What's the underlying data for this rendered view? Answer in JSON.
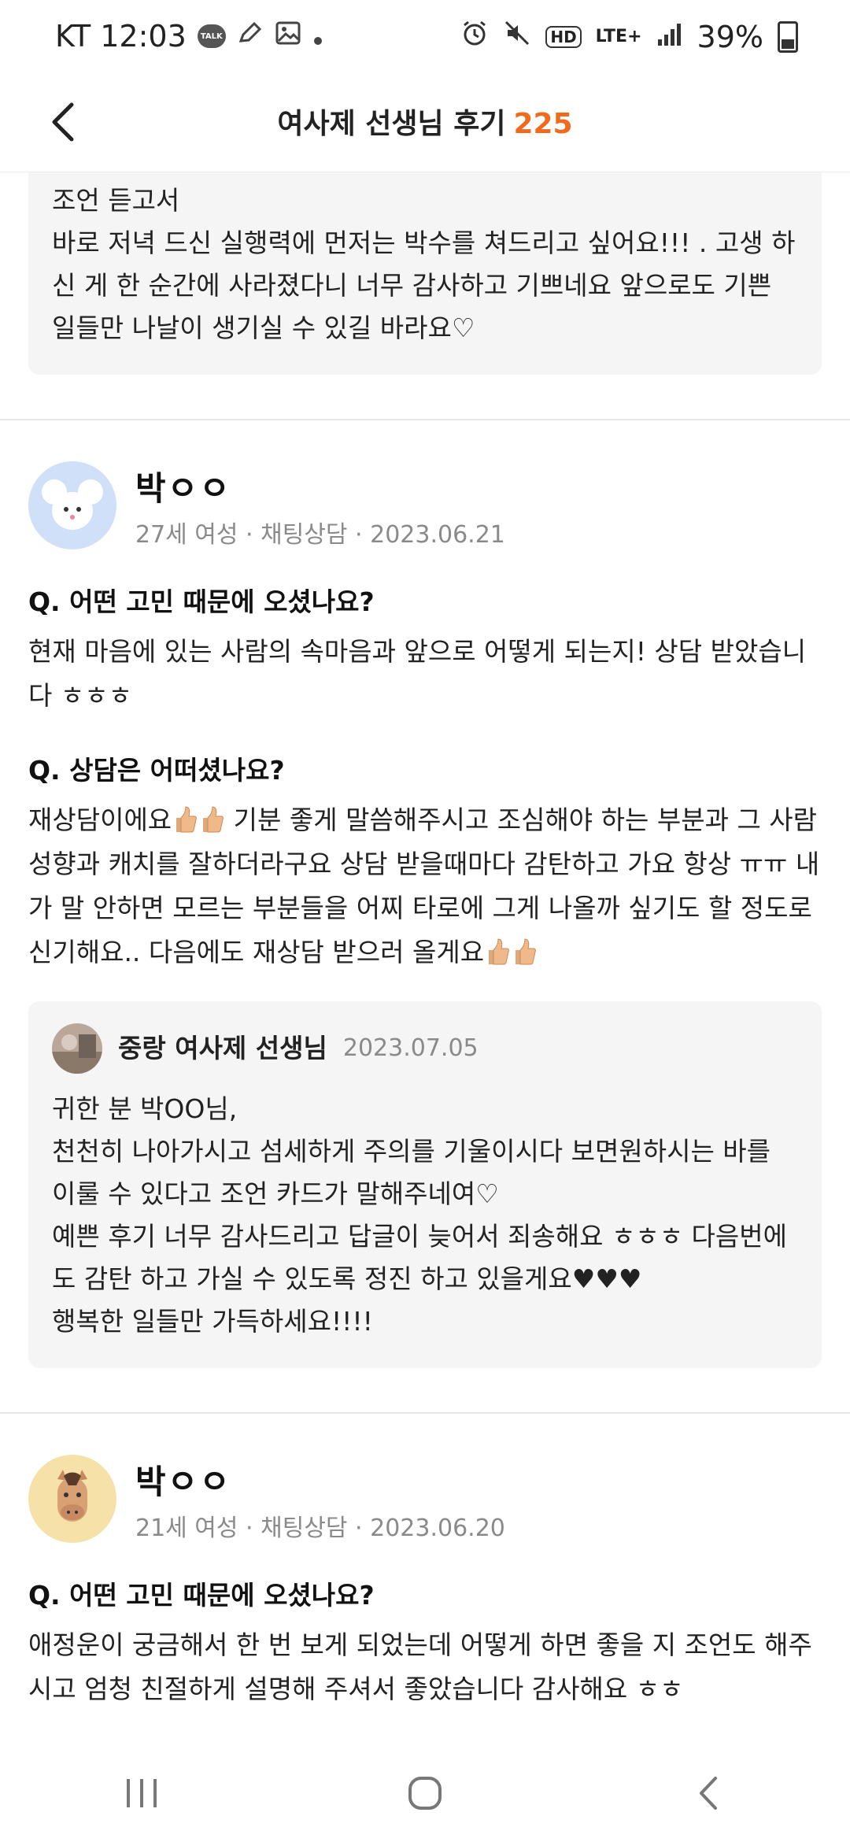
{
  "status_bar": {
    "carrier_time": "KT 12:03",
    "talk_label": "TALK",
    "network": "LTE+",
    "hd": "HD",
    "battery": "39%"
  },
  "header": {
    "title": "여사제 선생님 후기",
    "count": "225"
  },
  "top_reply": {
    "lines": [
      "조언 듣고서",
      "바로 저녁 드신 실행력에 먼저는 박수를 쳐드리고 싶어요!!! .  고생 하신 게 한 순간에 사라졌다니 너무 감사하고 기쁘네요 앞으로도 기쁜 일들만 나날이 생기실 수 있길 바라요♡"
    ]
  },
  "reviews": [
    {
      "name": "박ㅇㅇ",
      "meta": "27세 여성 · 채팅상담 · 2023.06.21",
      "q1": "Q. 어떤 고민 때문에 오셨나요?",
      "a1": "현재 마음에 있는 사람의 속마음과 앞으로 어떻게 되는지! 상담 받았습니다 ㅎㅎㅎ",
      "q2": "Q. 상담은 어떠셨나요?",
      "a2_part1": "재상담이에요",
      "a2_part2": " 기분 좋게 말씀해주시고 조심해야 하는 부분과 그 사람 성향과 캐치를 잘하더라구요 상담 받을때마다 감탄하고 가요 항상 ㅠㅠ 내가 말 안하면 모르는 부분들을 어찌 타로에 그게 나올까 싶기도 할 정도로 신기해요.. 다음에도 재상담 받으러 올게요",
      "reply": {
        "teacher": "중랑 여사제 선생님",
        "date": "2023.07.05",
        "lines": [
          "귀한 분 박OO님,",
          "천천히 나아가시고 섬세하게 주의를 기울이시다 보면원하시는 바를 이룰 수 있다고 조언 카드가 말해주네여♡",
          "예쁜 후기 너무 감사드리고 답글이 늦어서 죄송해요 ㅎㅎㅎ 다음번에도 감탄 하고 가실 수 있도록 정진 하고 있을게요♥♥♥",
          "행복한 일들만 가득하세요!!!!"
        ]
      }
    },
    {
      "name": "박ㅇㅇ",
      "meta": "21세 여성 · 채팅상담 · 2023.06.20",
      "q1": "Q. 어떤 고민 때문에 오셨나요?",
      "a1": "애정운이 궁금해서 한 번 보게 되었는데 어떻게 하면 좋을 지 조언도 해주시고 엄청 친절하게 설명해 주셔서 좋았습니다 감사해요 ㅎㅎ"
    }
  ],
  "icons": {
    "back": "chevron-left-icon",
    "avatar1": "mouse-avatar-icon",
    "avatar2": "horse-avatar-icon",
    "thumb": "thumbs-up-emoji-icon"
  },
  "colors": {
    "accent": "#f06a1e",
    "reply_bg": "#f5f5f5",
    "meta_text": "#8a8a8a"
  }
}
